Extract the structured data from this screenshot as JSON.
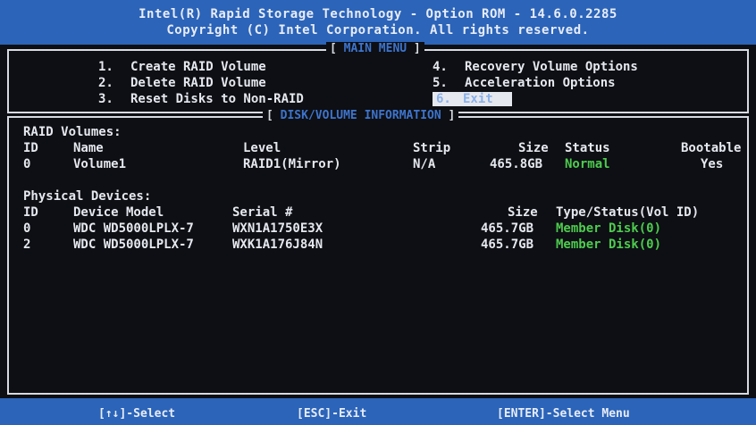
{
  "header": {
    "line1": "Intel(R) Rapid Storage Technology - Option ROM - 14.6.0.2285",
    "line2": "Copyright (C) Intel Corporation.  All rights reserved."
  },
  "main_menu": {
    "title": "MAIN MENU",
    "items": [
      {
        "num": "1.",
        "label": "Create RAID Volume"
      },
      {
        "num": "2.",
        "label": "Delete RAID Volume"
      },
      {
        "num": "3.",
        "label": "Reset Disks to Non-RAID"
      },
      {
        "num": "4.",
        "label": "Recovery Volume Options"
      },
      {
        "num": "5.",
        "label": "Acceleration Options"
      },
      {
        "num": "6.",
        "label": "Exit"
      }
    ],
    "selected_index": 5
  },
  "disk_info": {
    "title": "DISK/VOLUME INFORMATION",
    "raid_volumes_heading": "RAID Volumes:",
    "raid_columns": {
      "id": "ID",
      "name": "Name",
      "level": "Level",
      "strip": "Strip",
      "size": "Size",
      "status": "Status",
      "bootable": "Bootable"
    },
    "raid_rows": [
      {
        "id": "0",
        "name": "Volume1",
        "level": "RAID1(Mirror)",
        "strip": "N/A",
        "size": "465.8GB",
        "status": "Normal",
        "bootable": "Yes"
      }
    ],
    "physical_heading": "Physical Devices:",
    "physical_columns": {
      "id": "ID",
      "model": "Device Model",
      "serial": "Serial #",
      "size": "Size",
      "type": "Type/Status(Vol ID)"
    },
    "physical_rows": [
      {
        "id": "0",
        "model": "WDC WD5000LPLX-7",
        "serial": "WXN1A1750E3X",
        "size": "465.7GB",
        "type": "Member Disk(0)"
      },
      {
        "id": "2",
        "model": "WDC WD5000LPLX-7",
        "serial": "WXK1A176J84N",
        "size": "465.7GB",
        "type": "Member Disk(0)"
      }
    ]
  },
  "footer": {
    "select": "[↑↓]-Select",
    "exit": "[ESC]-Exit",
    "enter": "[ENTER]-Select Menu"
  },
  "colors": {
    "header_bg": "#2b64b8",
    "screen_bg": "#0d0f14",
    "status_ok": "#4ecb4e",
    "title_blue": "#3e74cc"
  }
}
